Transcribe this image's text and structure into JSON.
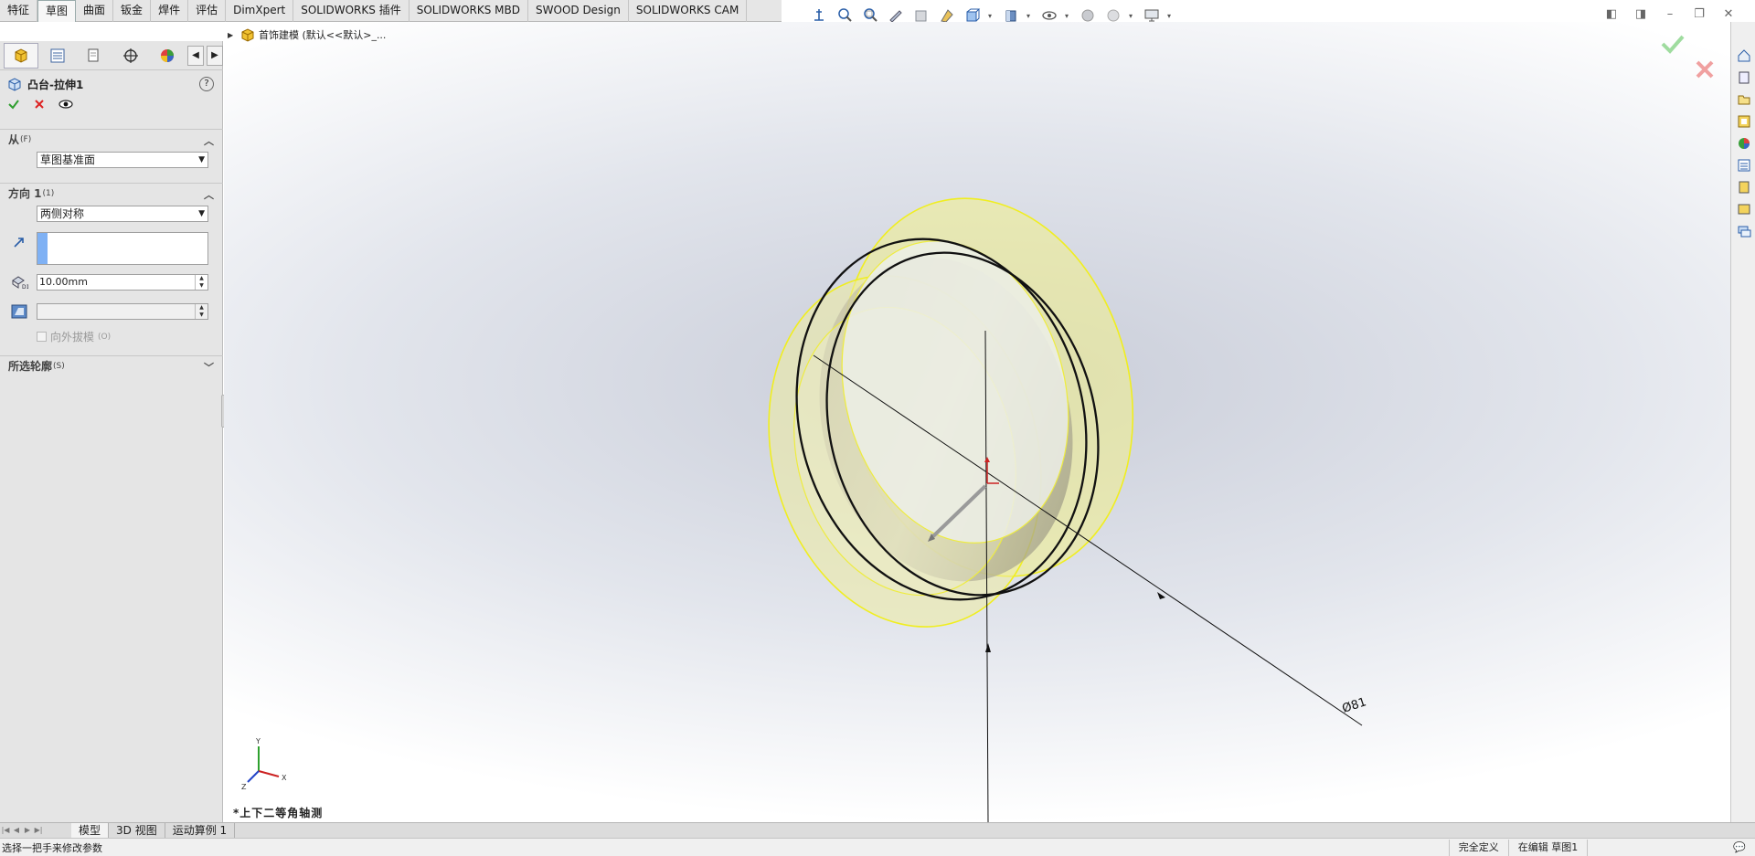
{
  "command_tabs": [
    "特征",
    "草图",
    "曲面",
    "钣金",
    "焊件",
    "评估",
    "DimXpert",
    "SOLIDWORKS 插件",
    "SOLIDWORKS MBD",
    "SWOOD Design",
    "SOLIDWORKS CAM"
  ],
  "active_command_tab": "草图",
  "property_manager": {
    "feature_title": "凸台-拉伸1",
    "help_label": "?",
    "from_section": {
      "label": "从",
      "shortcut": "(F)",
      "value": "草图基准面"
    },
    "direction_section": {
      "label": "方向 1",
      "shortcut": "(1)",
      "end_condition": "两侧对称",
      "depth": "10.00mm",
      "draft_outward_label": "向外拔模",
      "draft_outward_shortcut": "(O)"
    },
    "contours_section": {
      "label": "所选轮廓",
      "shortcut": "(S)"
    }
  },
  "viewport": {
    "tree_label": "首饰建模  (默认<<默认>_...",
    "view_name": "*上下二等角轴测",
    "dimension_text": "Ø81",
    "axis_labels": {
      "x": "X",
      "y": "Y",
      "z": "Z"
    }
  },
  "bottom_tabs": [
    "模型",
    "3D 视图",
    "运动算例 1"
  ],
  "active_bottom_tab": "模型",
  "status": {
    "message": "选择一把手来修改参数",
    "definition": "完全定义",
    "editing": "在编辑 草图1"
  },
  "colors": {
    "accent_blue": "#7fb1f4",
    "ok_green": "#2e9e2e",
    "cancel_red": "#d22",
    "part_yellow": "#f3f18a"
  }
}
